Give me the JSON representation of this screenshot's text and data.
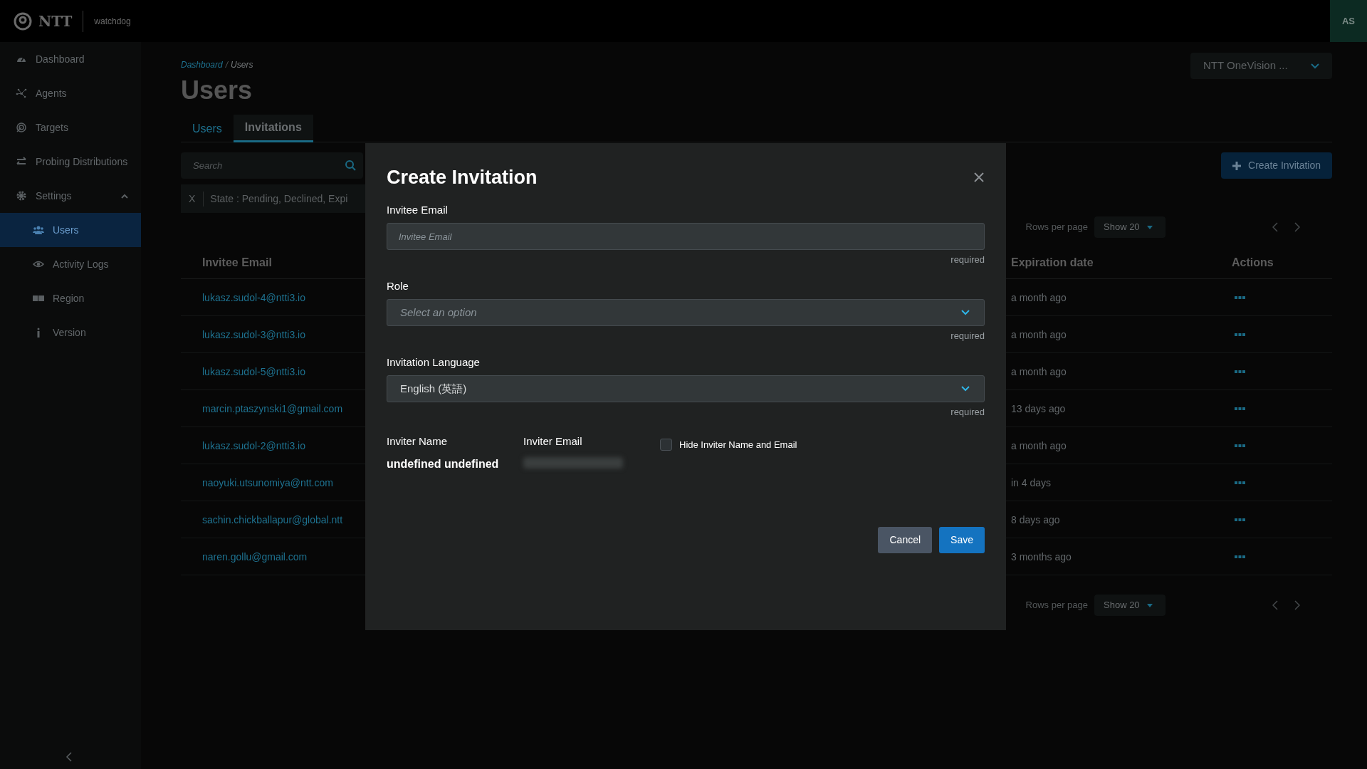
{
  "app": {
    "logo_text": "NTT",
    "product": "watchdog",
    "avatar": "AS"
  },
  "sidebar": {
    "items": [
      {
        "label": "Dashboard",
        "selected": false
      },
      {
        "label": "Agents",
        "selected": false
      },
      {
        "label": "Targets",
        "selected": false
      },
      {
        "label": "Probing Distributions",
        "selected": false
      },
      {
        "label": "Settings",
        "selected": false,
        "expanded": true,
        "children": [
          {
            "label": "Users",
            "selected": true
          },
          {
            "label": "Activity Logs",
            "selected": false
          },
          {
            "label": "Region",
            "selected": false
          },
          {
            "label": "Version",
            "selected": false
          }
        ]
      }
    ]
  },
  "breadcrumb": {
    "items": [
      "Dashboard",
      "Users"
    ],
    "separator": "/"
  },
  "page_title": "Users",
  "org_select": "NTT OneVision ...",
  "tabs": [
    {
      "label": "Users",
      "selected": false
    },
    {
      "label": "Invitations",
      "selected": true
    }
  ],
  "search": {
    "placeholder": "Search"
  },
  "filter_chip": {
    "remove": "X",
    "text": "State : Pending, Declined, Expi"
  },
  "create_button": "Create Invitation",
  "pagination_top": {
    "label": "Rows per page",
    "value": "Show 20"
  },
  "pagination_bottom": {
    "label": "Rows per page",
    "value": "Show 20"
  },
  "table": {
    "columns": [
      "Invitee Email",
      "Expiration date",
      "Actions"
    ],
    "rows": [
      {
        "email": "lukasz.sudol-4@ntti3.io",
        "expiration": "a month ago"
      },
      {
        "email": "lukasz.sudol-3@ntti3.io",
        "expiration": "a month ago"
      },
      {
        "email": "lukasz.sudol-5@ntti3.io",
        "expiration": "a month ago"
      },
      {
        "email": "marcin.ptaszynski1@gmail.com",
        "expiration": "13 days ago"
      },
      {
        "email": "lukasz.sudol-2@ntti3.io",
        "expiration": "a month ago"
      },
      {
        "email": "naoyuki.utsunomiya@ntt.com",
        "expiration": "in 4 days"
      },
      {
        "email": "sachin.chickballapur@global.ntt",
        "expiration": "8 days ago"
      },
      {
        "email": "naren.gollu@gmail.com",
        "expiration": "3 months ago"
      }
    ]
  },
  "modal": {
    "title": "Create Invitation",
    "fields": [
      {
        "label": "Invitee Email",
        "kind": "input",
        "placeholder": "Invitee Email",
        "hint": "required"
      },
      {
        "label": "Role",
        "kind": "select",
        "placeholder": "Select an option",
        "hint": "required"
      },
      {
        "label": "Invitation Language",
        "kind": "select",
        "value": "English (英語)",
        "hint": "required"
      }
    ],
    "inviter": {
      "name_label": "Inviter Name",
      "name": "undefined undefined",
      "email_label": "Inviter Email"
    },
    "hide_checkbox": {
      "label": "Hide Inviter Name and Email",
      "checked": false
    },
    "buttons": [
      {
        "label": "Cancel",
        "kind": "secondary"
      },
      {
        "label": "Save",
        "kind": "primary"
      }
    ]
  }
}
